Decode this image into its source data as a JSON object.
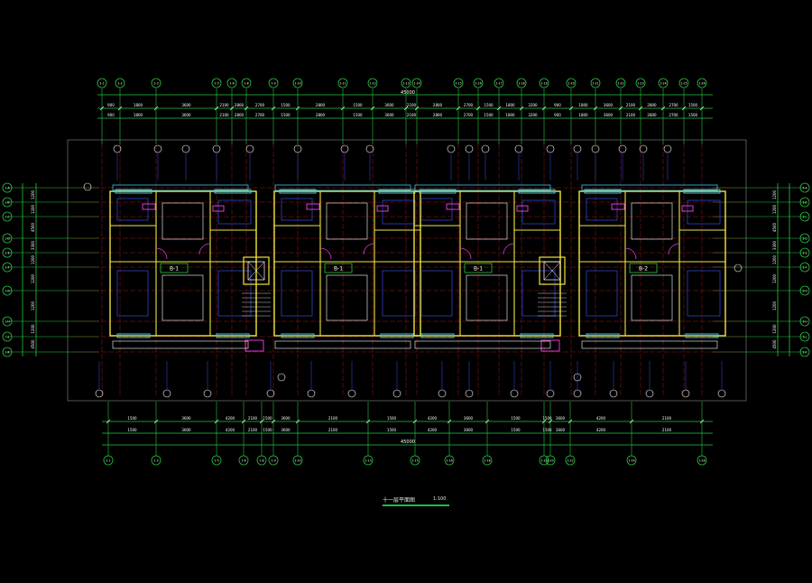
{
  "drawing": {
    "title": "十一层平面图",
    "scale": "1:100",
    "colors": {
      "background": "#000000",
      "dimension": "#27c93f",
      "wall": "#f2e43c",
      "detail": "#ffffff",
      "axis": "#c02020",
      "furniture": "#3340c8",
      "window": "#39c6ef",
      "accent": "#e03ad4"
    },
    "overall_dimension": "45000",
    "unit_labels": [
      "B-1",
      "B-1",
      "B-1",
      "B-2"
    ],
    "top_axes": [
      "1-1",
      "1-2",
      "1-3",
      "1-5",
      "1-6",
      "1-8",
      "1-9",
      "1-10",
      "1-11",
      "1-12",
      "1-13",
      "1-14",
      "1-15",
      "1-16",
      "1-17",
      "1-18",
      "1-19",
      "1-20",
      "1-21",
      "1-22",
      "1-23",
      "1-24",
      "1-25",
      "1-26"
    ],
    "bottom_axes": [
      "1-1",
      "1-3",
      "1-5",
      "1-6",
      "1-8",
      "1-9",
      "1-10",
      "1-13",
      "1-15",
      "1-16",
      "1-18",
      "1-19",
      "1-20",
      "1-22",
      "1-24",
      "1-26"
    ],
    "left_axes": [
      "1-A",
      "1-B",
      "1-C",
      "1-D",
      "1-E",
      "1-F",
      "1-G",
      "1-H",
      "1-J",
      "1-K"
    ],
    "top_dims": [
      "900",
      "1800",
      "3600",
      "2100",
      "2800",
      "2700",
      "1500",
      "2800",
      "1500",
      "3600",
      "2100",
      "2800",
      "2700",
      "1500",
      "1800",
      "3200"
    ],
    "bottom_dims": [
      "1500",
      "3600",
      "4200",
      "2100",
      "1500",
      "3600",
      "2100",
      "1500",
      "4200",
      "3600",
      "1500"
    ],
    "left_dims": [
      "1200",
      "1200",
      "4500",
      "3300",
      "1200",
      "1200"
    ]
  }
}
